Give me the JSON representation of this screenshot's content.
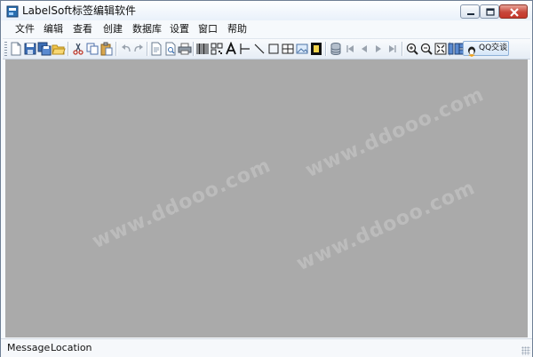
{
  "window": {
    "title": "LabelSoft标签编辑软件"
  },
  "menu": [
    "文件",
    "编辑",
    "查看",
    "创建",
    "数据库",
    "设置",
    "窗口",
    "帮助"
  ],
  "toolbar": {
    "qq_label": "QQ交谈"
  },
  "watermark": {
    "text": "www.ddooo.com"
  },
  "status": {
    "message_label": "Message",
    "location_label": "Location"
  },
  "colors": {
    "workspace": "#aaaaaa",
    "close_button": "#c5392b",
    "accent": "#3a7bd5"
  }
}
